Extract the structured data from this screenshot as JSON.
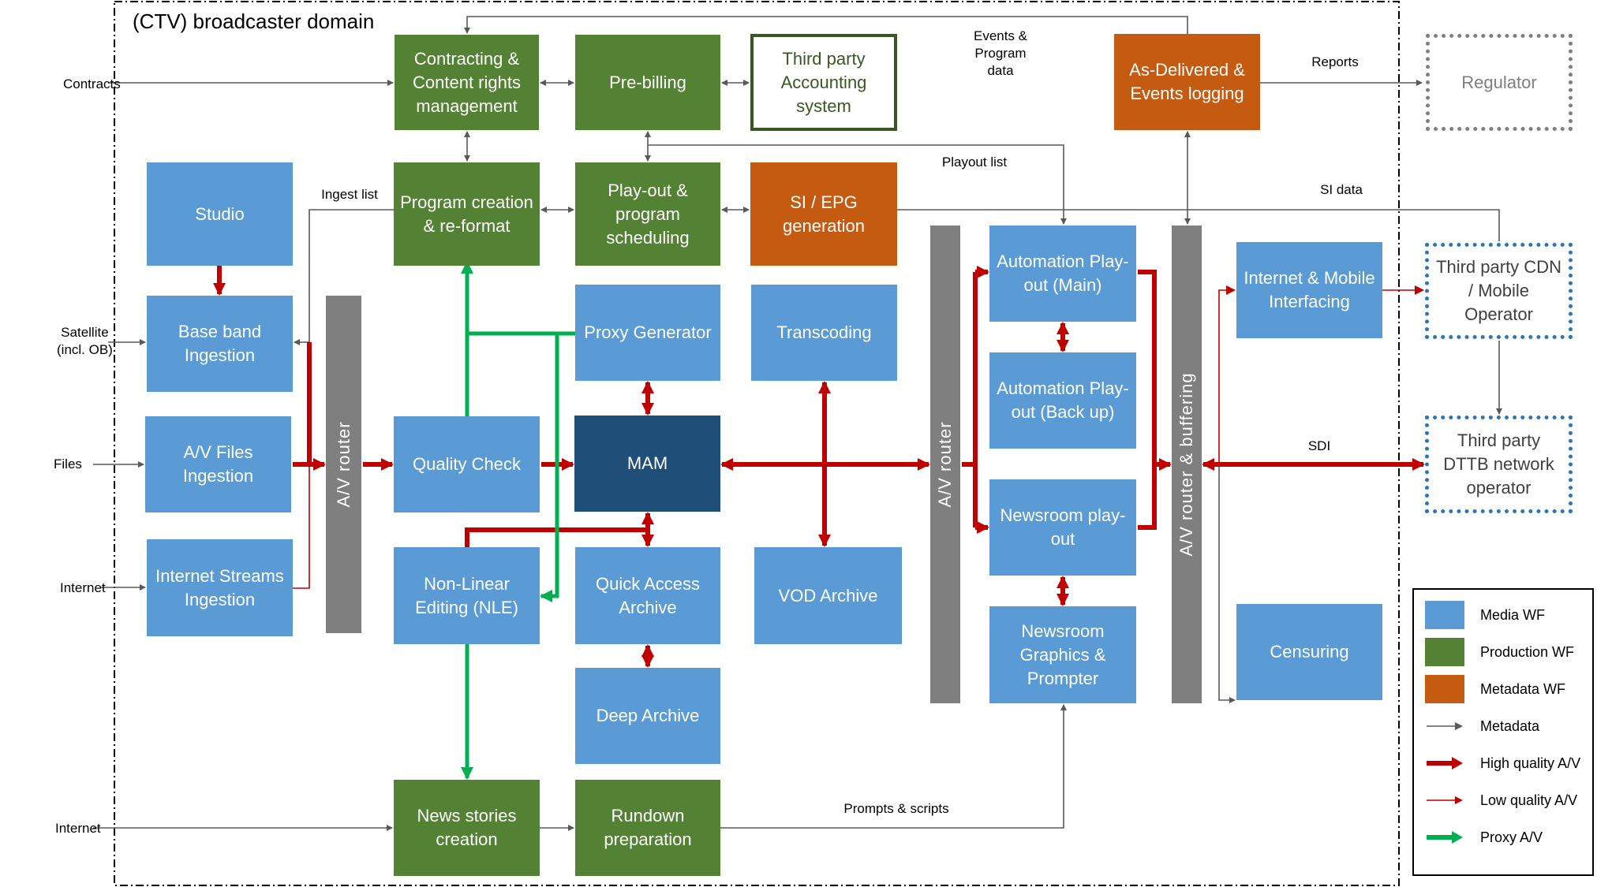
{
  "domain_title": "(CTV) broadcaster domain",
  "boxes": {
    "contracting": {
      "label": "Contracting & Content rights management",
      "category": "Production WF"
    },
    "prebilling": {
      "label": "Pre-billing",
      "category": "Production WF"
    },
    "accounting": {
      "label": "Third party Accounting system",
      "category": "External"
    },
    "asdelivered": {
      "label": "As-Delivered & Events logging",
      "category": "Metadata WF"
    },
    "regulator": {
      "label": "Regulator",
      "category": "External"
    },
    "studio": {
      "label": "Studio",
      "category": "Media WF"
    },
    "program": {
      "label": "Program creation & re-format",
      "category": "Production WF"
    },
    "playout_sched": {
      "label": "Play-out & program scheduling",
      "category": "Production WF"
    },
    "si_epg": {
      "label": "SI / EPG generation",
      "category": "Metadata WF"
    },
    "baseband": {
      "label": "Base band Ingestion",
      "category": "Media WF"
    },
    "avfiles": {
      "label": "A/V Files Ingestion",
      "category": "Media WF"
    },
    "inetstreams": {
      "label": "Internet Streams Ingestion",
      "category": "Media WF"
    },
    "qc": {
      "label": "Quality Check",
      "category": "Media WF"
    },
    "nle": {
      "label": "Non-Linear Editing (NLE)",
      "category": "Media WF"
    },
    "proxy": {
      "label": "Proxy Generator",
      "category": "Media WF"
    },
    "mam": {
      "label": "MAM",
      "category": "Media WF"
    },
    "quick": {
      "label": "Quick Access Archive",
      "category": "Media WF"
    },
    "deep": {
      "label": "Deep Archive",
      "category": "Media WF"
    },
    "transcoding": {
      "label": "Transcoding",
      "category": "Media WF"
    },
    "vod": {
      "label": "VOD Archive",
      "category": "Media WF"
    },
    "auto_main": {
      "label": "Automation Play-out (Main)",
      "category": "Media WF"
    },
    "auto_backup": {
      "label": "Automation Play-out (Back up)",
      "category": "Media WF"
    },
    "news_playout": {
      "label": "Newsroom play-out",
      "category": "Media WF"
    },
    "news_graphics": {
      "label": "Newsroom Graphics & Prompter",
      "category": "Media WF"
    },
    "inet_mobile": {
      "label": "Internet & Mobile Interfacing",
      "category": "Media WF"
    },
    "censuring": {
      "label": "Censuring",
      "category": "Media WF"
    },
    "cdn": {
      "label": "Third party CDN / Mobile Operator",
      "category": "External"
    },
    "dttb": {
      "label": "Third party DTTB network operator",
      "category": "External"
    },
    "news_stories": {
      "label": "News stories creation",
      "category": "Production WF"
    },
    "rundown": {
      "label": "Rundown preparation",
      "category": "Production WF"
    }
  },
  "routers": {
    "router1": "A/V router",
    "router2": "A/V router",
    "router3": "A/V router  & buffering"
  },
  "labels": {
    "contracts": "Contracts",
    "satellite": "Satellite\n(incl. OB)",
    "files": "Files",
    "internet1": "Internet",
    "internet2": "Internet",
    "ingest_list": "Ingest list",
    "events_program": "Events &\nProgram\ndata",
    "playout_list": "Playout list",
    "reports": "Reports",
    "si_data": "SI data",
    "sdi": "SDI",
    "prompts": "Prompts & scripts"
  },
  "legend": {
    "items": [
      {
        "label": "Media WF",
        "kind": "swatch",
        "color": "#5b9bd5"
      },
      {
        "label": "Production WF",
        "kind": "swatch",
        "color": "#548235"
      },
      {
        "label": "Metadata WF",
        "kind": "swatch",
        "color": "#c55a11"
      },
      {
        "label": "Metadata",
        "kind": "arrow-thin",
        "color": "#595959"
      },
      {
        "label": "High quality A/V",
        "kind": "arrow-thick",
        "color": "#c00000"
      },
      {
        "label": "Low quality A/V",
        "kind": "arrow-thin",
        "color": "#c00000"
      },
      {
        "label": "Proxy A/V",
        "kind": "arrow-thick",
        "color": "#00b050"
      }
    ]
  },
  "colors": {
    "media": "#5b9bd5",
    "mam": "#1f4e79",
    "production": "#548235",
    "metadata": "#c55a11",
    "router": "#7f7f7f",
    "high_quality": "#c00000",
    "proxy": "#00b050",
    "metadata_line": "#595959"
  }
}
